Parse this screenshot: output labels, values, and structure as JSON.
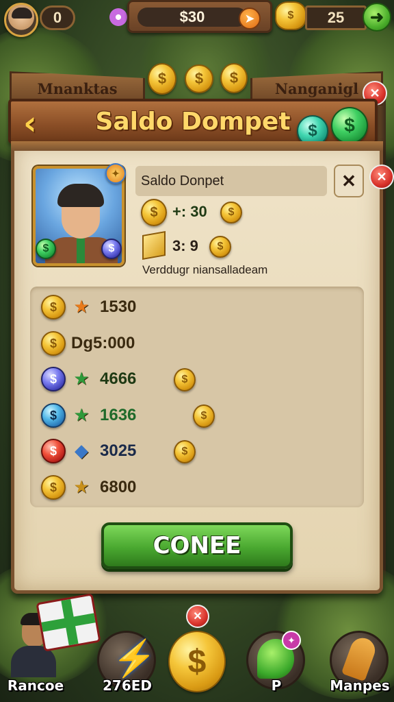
{
  "hud": {
    "left_counter": "0",
    "balance": "$30",
    "right_counter": "25"
  },
  "banner": {
    "left_tab": "Mnanktas",
    "right_tab": "Nanganigl",
    "title": "Saldo Dompet"
  },
  "profile": {
    "name": "Saldo Donpet",
    "stat1_value": "+: 30",
    "stat2_value": "3: 9",
    "description": "Verddugr niansalladeam"
  },
  "rows": [
    {
      "value": "1530",
      "color": "#3a2a10",
      "coin": "gold",
      "gem": "star-icon",
      "gem_color": "#e87a1a"
    },
    {
      "value": "Dg5:000",
      "color": "#3a2a10",
      "coin": "gold",
      "gem": "",
      "gem_color": ""
    },
    {
      "value": "4666",
      "color": "#1f3a14",
      "coin": "blue",
      "gem": "star-icon",
      "gem_color": "#2e9a3a",
      "extra_coin": true
    },
    {
      "value": "1636",
      "color": "#1f6a2a",
      "coin": "cyan",
      "gem": "star-icon",
      "gem_color": "#2e9a3a",
      "extra_coin": true
    },
    {
      "value": "3025",
      "color": "#1a2a4a",
      "coin": "red",
      "gem": "badge-icon",
      "gem_color": "#3a78c8",
      "extra_coin": true
    },
    {
      "value": "6800",
      "color": "#3a2a10",
      "coin": "gold",
      "gem": "star-icon",
      "gem_color": "#c8901a"
    }
  ],
  "primary_button": "CONEE",
  "nav": [
    {
      "label": "Rancoe"
    },
    {
      "label": "276ED"
    },
    {
      "label": ""
    },
    {
      "label": "P"
    },
    {
      "label": "Manpes"
    }
  ]
}
